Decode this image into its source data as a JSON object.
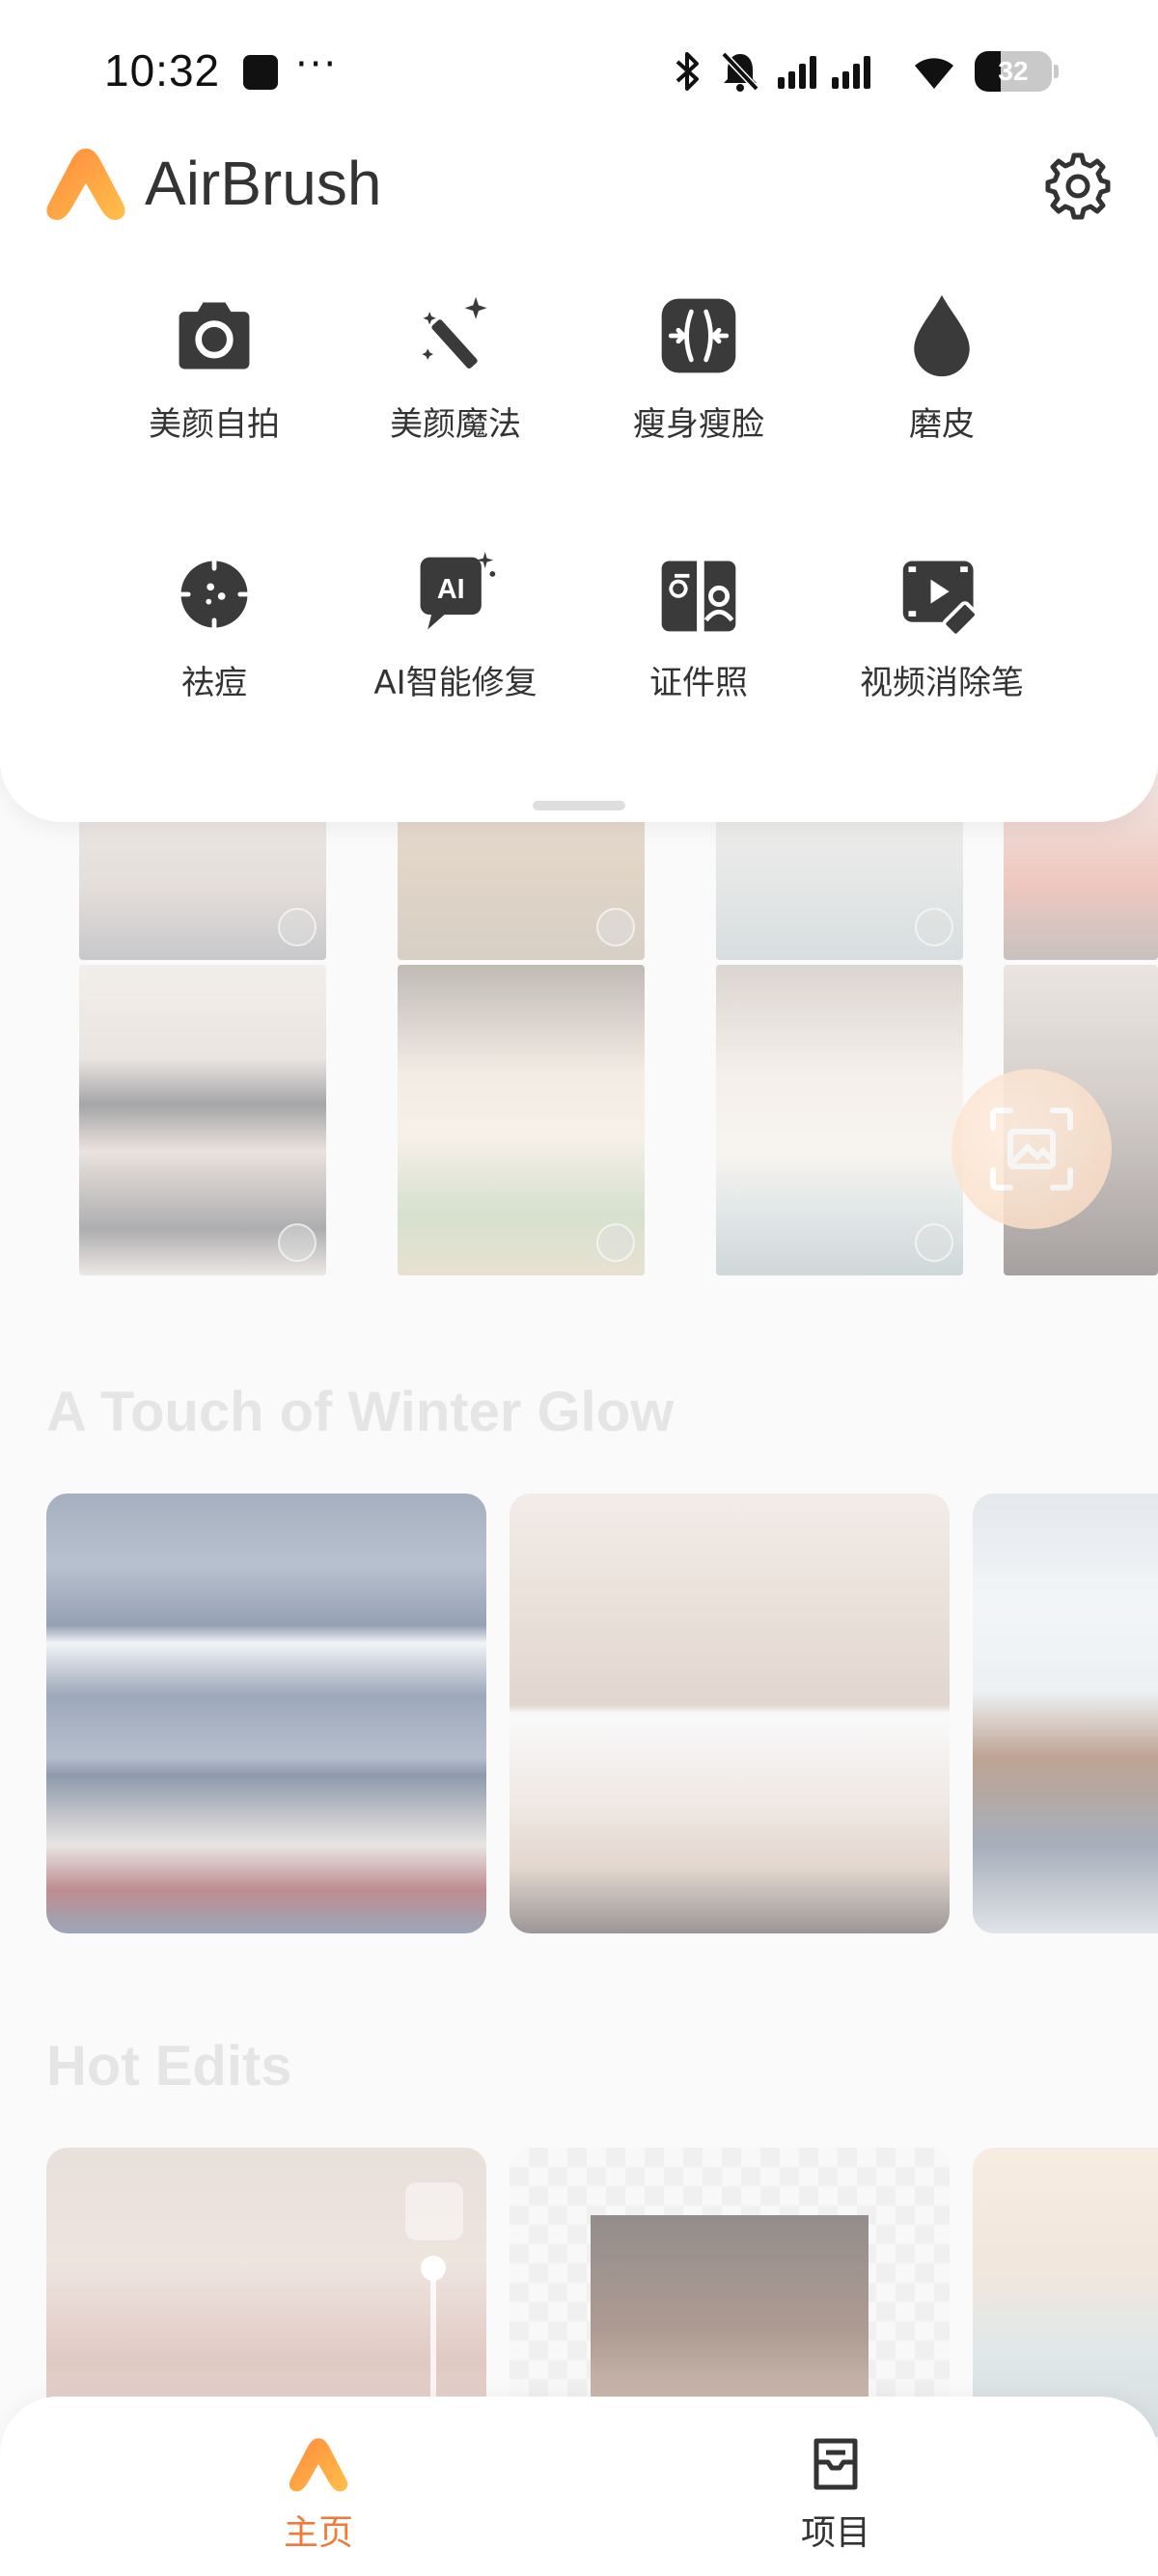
{
  "status_bar": {
    "time": "10:32",
    "dots": "···",
    "battery": "32"
  },
  "app": {
    "name": "AirBrush"
  },
  "tools": [
    {
      "label": "美颜自拍",
      "icon": "camera-icon"
    },
    {
      "label": "美颜魔法",
      "icon": "magic-wand-icon"
    },
    {
      "label": "瘦身瘦脸",
      "icon": "slim-icon"
    },
    {
      "label": "磨皮",
      "icon": "drop-icon"
    },
    {
      "label": "祛痘",
      "icon": "acne-icon"
    },
    {
      "label": "AI智能修复",
      "icon": "ai-repair-icon"
    },
    {
      "label": "证件照",
      "icon": "id-photo-icon"
    },
    {
      "label": "视频消除笔",
      "icon": "video-eraser-icon"
    }
  ],
  "sections": {
    "winter": "A Touch of Winter Glow",
    "hot": "Hot Edits"
  },
  "nav": {
    "home": "主页",
    "projects": "项目"
  },
  "colors": {
    "accent": "#f07a3a",
    "icon_dark": "#3a3a3a"
  }
}
